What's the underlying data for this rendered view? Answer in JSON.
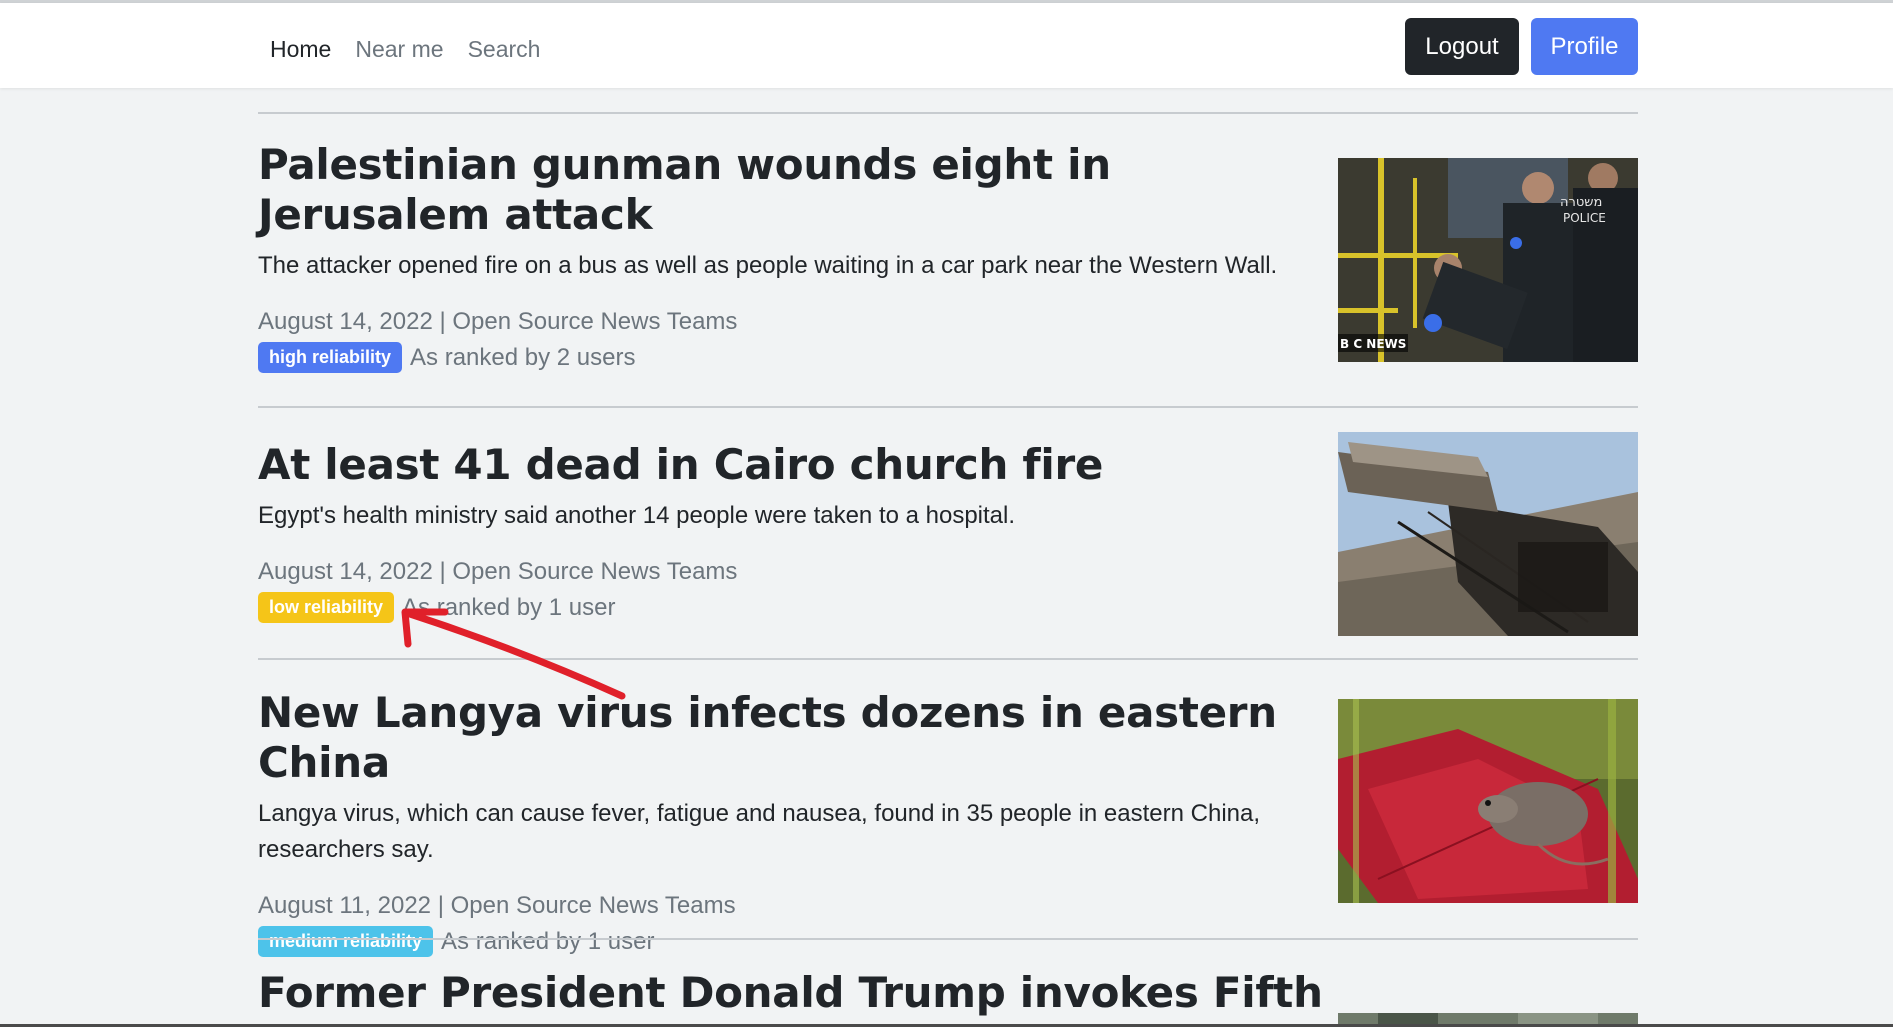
{
  "nav": {
    "links": [
      "Home",
      "Near me",
      "Search"
    ],
    "logout_label": "Logout",
    "profile_label": "Profile"
  },
  "articles": [
    {
      "title": "Palestinian gunman wounds eight in Jerusalem attack",
      "summary": "The attacker opened fire on a bus as well as people waiting in a car park near the Western Wall.",
      "meta": "August 14, 2022 | Open Source News Teams",
      "badge": "high reliability",
      "badge_color": "#4f79f2",
      "ranked": "As ranked by 2 users",
      "image_caption": "BBC NEWS",
      "image_text": "משטרה POLICE"
    },
    {
      "title": "At least 41 dead in Cairo church fire",
      "summary": "Egypt's health ministry said another 14 people were taken to a hospital.",
      "meta": "August 14, 2022 | Open Source News Teams",
      "badge": "low reliability",
      "badge_color": "#f5c518",
      "ranked": "As ranked by 1 user"
    },
    {
      "title": "New Langya virus infects dozens in eastern China",
      "summary": "Langya virus, which can cause fever, fatigue and nausea, found in 35 people in eastern China, researchers say.",
      "meta": "August 11, 2022 | Open Source News Teams",
      "badge": "medium reliability",
      "badge_color": "#4dc3ea",
      "ranked": "As ranked by 1 user"
    },
    {
      "title": "Former President Donald Trump invokes Fifth"
    }
  ],
  "annotation": {
    "color": "#e0202a"
  }
}
